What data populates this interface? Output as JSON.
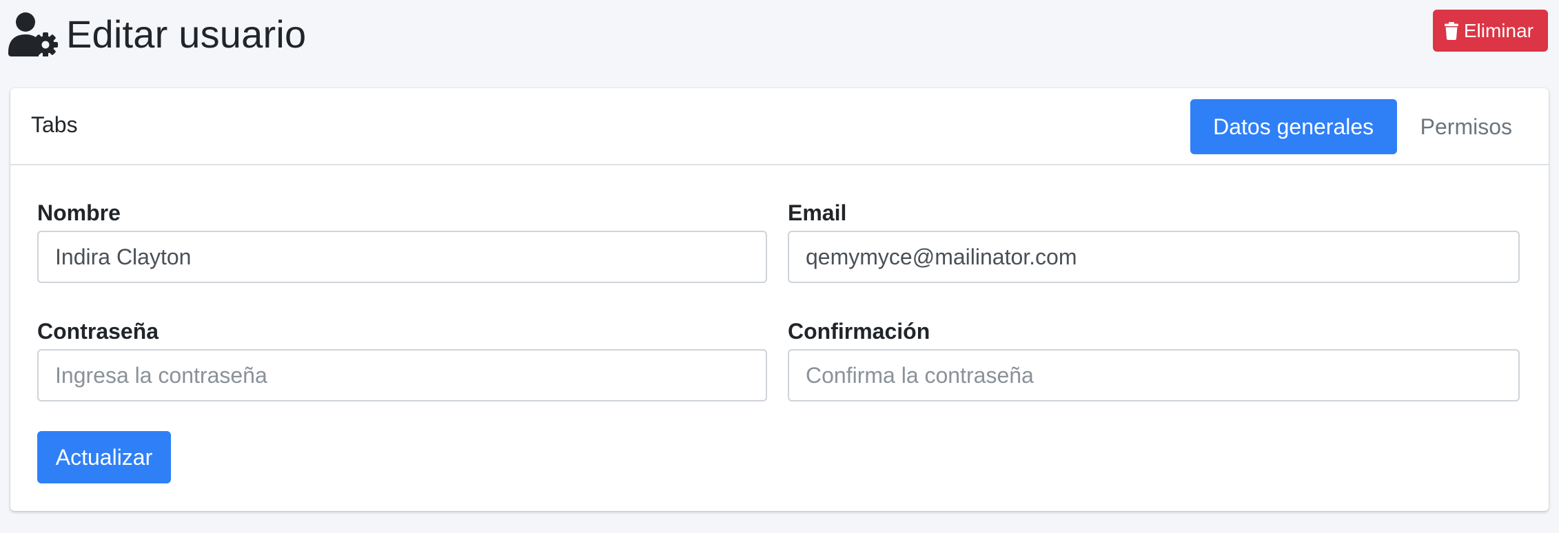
{
  "header": {
    "title": "Editar usuario",
    "title_icon": "user-cog-icon",
    "delete_button": {
      "label": "Eliminar",
      "icon": "trash-icon",
      "color": "#dc3545"
    }
  },
  "card": {
    "header_title": "Tabs",
    "tabs": [
      {
        "label": "Datos generales",
        "active": true
      },
      {
        "label": "Permisos",
        "active": false
      }
    ]
  },
  "form": {
    "name": {
      "label": "Nombre",
      "value": "Indira Clayton",
      "placeholder": ""
    },
    "email": {
      "label": "Email",
      "value": "qemymyce@mailinator.com",
      "placeholder": ""
    },
    "password": {
      "label": "Contraseña",
      "value": "",
      "placeholder": "Ingresa la contraseña"
    },
    "confirmation": {
      "label": "Confirmación",
      "value": "",
      "placeholder": "Confirma la contraseña"
    },
    "submit_label": "Actualizar"
  },
  "colors": {
    "primary": "#2f80f7",
    "danger": "#dc3545",
    "background": "#f4f6f9",
    "text": "#212529"
  }
}
